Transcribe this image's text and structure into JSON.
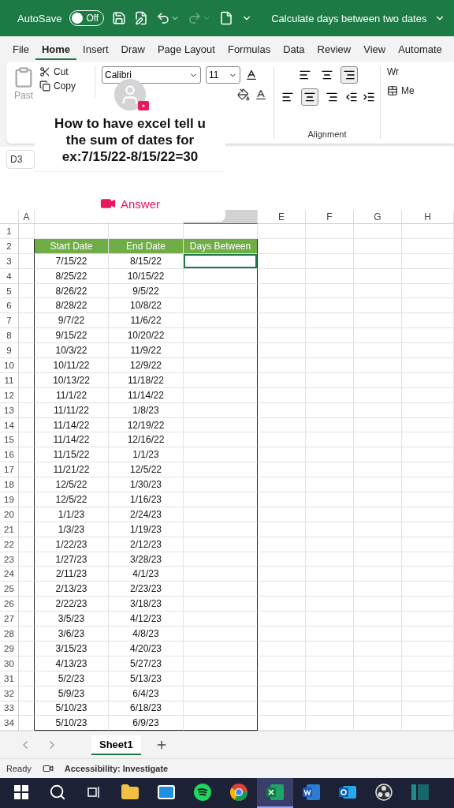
{
  "title_bar": {
    "autosave_label": "AutoSave",
    "autosave": {
      "on": false,
      "label": "Off"
    },
    "redo_disabled": true,
    "document_title": "Calculate days between two dates"
  },
  "ribbon_tabs": [
    {
      "label": "File",
      "selected": false
    },
    {
      "label": "Home",
      "selected": true
    },
    {
      "label": "Insert",
      "selected": false
    },
    {
      "label": "Draw",
      "selected": false
    },
    {
      "label": "Page Layout",
      "selected": false
    },
    {
      "label": "Formulas",
      "selected": false
    },
    {
      "label": "Data",
      "selected": false
    },
    {
      "label": "Review",
      "selected": false
    },
    {
      "label": "View",
      "selected": false
    },
    {
      "label": "Automate",
      "selected": false
    }
  ],
  "ribbon": {
    "paste": "Past",
    "cut": "Cut",
    "copy": "Copy",
    "font": "Calibri",
    "font_size": "11",
    "alignment_label": "Alignment",
    "wrap": "Wr",
    "merge": "Me",
    "center_selected": true
  },
  "name_box": "D3",
  "overlay": {
    "question": "How to have excel tell u the sum of dates for ex:7/15/22-8/15/22=30",
    "answer": "Answer"
  },
  "column_headers": [
    {
      "label": "A",
      "selected": false
    },
    {
      "selected": true
    },
    {
      "label": "E",
      "selected": false
    },
    {
      "label": "F",
      "selected": false
    },
    {
      "label": "G",
      "selected": false
    },
    {
      "label": "H",
      "selected": false
    }
  ],
  "row_numbers": [
    "1",
    "2",
    "3",
    "4",
    "5",
    "6",
    "7",
    "8",
    "9",
    "10",
    "11",
    "12",
    "13",
    "14",
    "15",
    "16",
    "17",
    "18",
    "19",
    "20",
    "21",
    "22",
    "23",
    "24",
    "25",
    "26",
    "27",
    "28",
    "29",
    "30",
    "31",
    "32",
    "33",
    "34"
  ],
  "table": {
    "header": [
      "Start Date",
      "End Date",
      "Days Between"
    ],
    "rows": [
      {
        "start": "7/15/22",
        "end": "8/15/22",
        "active": true
      },
      {
        "start": "8/25/22",
        "end": "10/15/22",
        "active": false
      },
      {
        "start": "8/26/22",
        "end": "9/5/22",
        "active": false
      },
      {
        "start": "8/28/22",
        "end": "10/8/22",
        "active": false
      },
      {
        "start": "9/7/22",
        "end": "11/6/22",
        "active": false
      },
      {
        "start": "9/15/22",
        "end": "10/20/22",
        "active": false
      },
      {
        "start": "10/3/22",
        "end": "11/9/22",
        "active": false
      },
      {
        "start": "10/11/22",
        "end": "12/9/22",
        "active": false
      },
      {
        "start": "10/13/22",
        "end": "11/18/22",
        "active": false
      },
      {
        "start": "11/1/22",
        "end": "11/14/22",
        "active": false
      },
      {
        "start": "11/11/22",
        "end": "1/8/23",
        "active": false
      },
      {
        "start": "11/14/22",
        "end": "12/19/22",
        "active": false
      },
      {
        "start": "11/14/22",
        "end": "12/16/22",
        "active": false
      },
      {
        "start": "11/15/22",
        "end": "1/1/23",
        "active": false
      },
      {
        "start": "11/21/22",
        "end": "12/5/22",
        "active": false
      },
      {
        "start": "12/5/22",
        "end": "1/30/23",
        "active": false
      },
      {
        "start": "12/5/22",
        "end": "1/16/23",
        "active": false
      },
      {
        "start": "1/1/23",
        "end": "2/24/23",
        "active": false
      },
      {
        "start": "1/3/23",
        "end": "1/19/23",
        "active": false
      },
      {
        "start": "1/22/23",
        "end": "2/12/23",
        "active": false
      },
      {
        "start": "1/27/23",
        "end": "3/28/23",
        "active": false
      },
      {
        "start": "2/11/23",
        "end": "4/1/23",
        "active": false
      },
      {
        "start": "2/13/23",
        "end": "2/23/23",
        "active": false
      },
      {
        "start": "2/22/23",
        "end": "3/18/23",
        "active": false
      },
      {
        "start": "3/5/23",
        "end": "4/12/23",
        "active": false
      },
      {
        "start": "3/6/23",
        "end": "4/8/23",
        "active": false
      },
      {
        "start": "3/15/23",
        "end": "4/20/23",
        "active": false
      },
      {
        "start": "4/13/23",
        "end": "5/27/23",
        "active": false
      },
      {
        "start": "5/2/23",
        "end": "5/13/23",
        "active": false
      },
      {
        "start": "5/9/23",
        "end": "6/4/23",
        "active": false
      },
      {
        "start": "5/10/23",
        "end": "6/18/23",
        "active": false
      },
      {
        "start": "5/10/23",
        "end": "6/9/23",
        "active": false
      }
    ]
  },
  "sheet_tabs": [
    {
      "label": "Sheet1",
      "selected": true
    }
  ],
  "status_bar": {
    "ready": "Ready",
    "accessibility": "Accessibility: Investigate"
  },
  "taskbar": [
    {
      "kind": "start",
      "selected": false
    },
    {
      "kind": "search",
      "selected": false
    },
    {
      "kind": "taskview",
      "selected": false
    },
    {
      "kind": "folder",
      "selected": false
    },
    {
      "kind": "mail",
      "selected": false
    },
    {
      "kind": "music",
      "selected": false
    },
    {
      "kind": "browser",
      "selected": false
    },
    {
      "kind": "sheet",
      "selected": true
    },
    {
      "kind": "doc",
      "selected": false
    },
    {
      "kind": "outlook",
      "selected": false
    },
    {
      "kind": "record",
      "selected": false
    },
    {
      "kind": "panel",
      "selected": false
    }
  ]
}
